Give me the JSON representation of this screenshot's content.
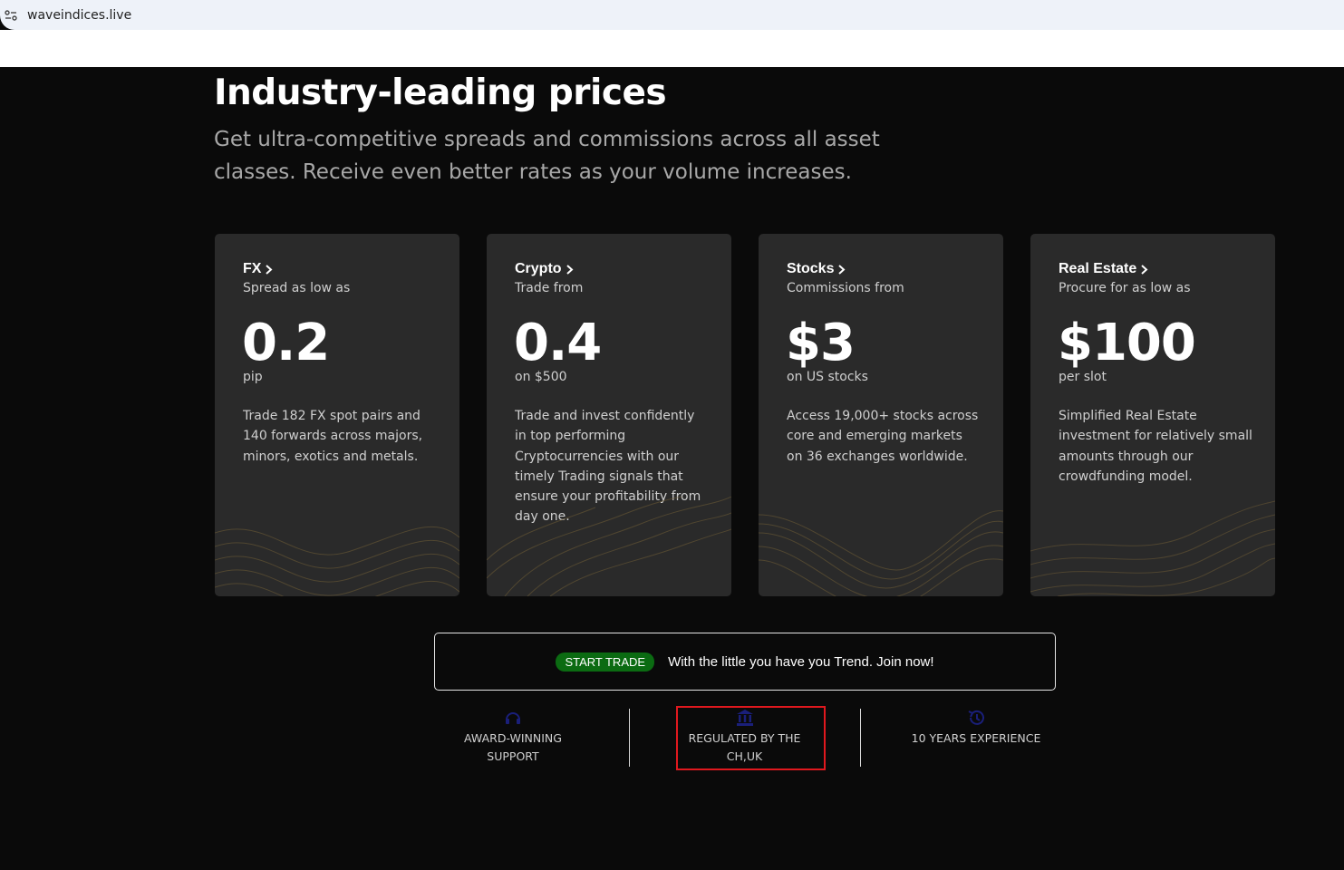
{
  "browser": {
    "url": "waveindices.live"
  },
  "hero": {
    "title": "Industry-leading prices",
    "subtitle": "Get ultra-competitive spreads and commissions across all asset classes. Receive even better rates as your volume increases."
  },
  "cards": [
    {
      "title": "FX",
      "subtitle": "Spread as low as",
      "price": "0.2",
      "unit": "pip",
      "description": "Trade 182 FX spot pairs and 140 forwards across majors, minors, exotics and metals."
    },
    {
      "title": "Crypto",
      "subtitle": "Trade from",
      "price": "0.4",
      "unit": "on $500",
      "description": "Trade and invest confidently in top performing Cryptocurrencies with our timely Trading signals that ensure your profitability from day one."
    },
    {
      "title": "Stocks",
      "subtitle": "Commissions from",
      "price": "$3",
      "unit": "on US stocks",
      "description": "Access 19,000+ stocks across core and emerging markets on 36 exchanges worldwide."
    },
    {
      "title": "Real Estate",
      "subtitle": "Procure for as low as",
      "price": "$100",
      "unit": "per slot",
      "description": "Simplified Real Estate investment for relatively small amounts through our crowdfunding model."
    }
  ],
  "cta": {
    "badge": "START TRADE",
    "text": "With the little you have you Trend. Join now!"
  },
  "features": [
    {
      "label_line1": "AWARD-WINNING",
      "label_line2": "SUPPORT",
      "icon": "headset-icon"
    },
    {
      "label_line1": "REGULATED BY THE",
      "label_line2": "CH,UK",
      "icon": "bank-icon"
    },
    {
      "label_line1": "10 YEARS EXPERIENCE",
      "label_line2": "",
      "icon": "history-icon"
    }
  ],
  "colors": {
    "background": "#0a0a0a",
    "card": "#2a2a2a",
    "badge": "#0b6b12",
    "wave": "#6b5a35",
    "icon": "#1a1f7a",
    "highlight": "#e0181e"
  }
}
